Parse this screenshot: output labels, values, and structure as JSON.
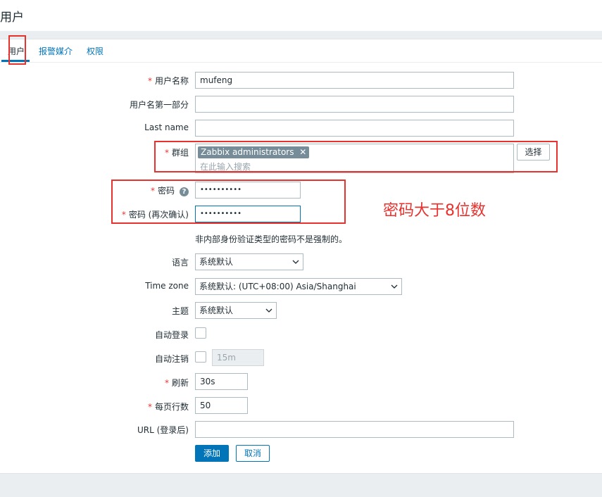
{
  "page": {
    "title": "用户"
  },
  "tabs": [
    {
      "label": "用户",
      "active": true
    },
    {
      "label": "报警媒介",
      "active": false
    },
    {
      "label": "权限",
      "active": false
    }
  ],
  "form": {
    "username": {
      "label": "用户名称",
      "value": "mufeng",
      "required": true
    },
    "first_name": {
      "label": "用户名第一部分",
      "value": ""
    },
    "last_name": {
      "label": "Last name",
      "value": ""
    },
    "groups": {
      "label": "群组",
      "required": true,
      "chips": [
        "Zabbix administrators"
      ],
      "placeholder": "在此输入搜索",
      "select_button": "选择"
    },
    "password": {
      "label": "密码",
      "mask": "••••••••••",
      "required": true,
      "help_icon": "question-circle-icon"
    },
    "password_confirm": {
      "label": "密码 (再次确认)",
      "mask": "••••••••••",
      "required": true
    },
    "password_hint": "非内部身份验证类型的密码不是强制的。",
    "language": {
      "label": "语言",
      "value": "系统默认"
    },
    "timezone": {
      "label": "Time zone",
      "value": "系统默认: (UTC+08:00) Asia/Shanghai"
    },
    "theme": {
      "label": "主题",
      "value": "系统默认"
    },
    "autologin": {
      "label": "自动登录",
      "checked": false
    },
    "autologout": {
      "label": "自动注销",
      "checked": false,
      "value": "15m"
    },
    "refresh": {
      "label": "刷新",
      "value": "30s",
      "required": true
    },
    "rows_per_page": {
      "label": "每页行数",
      "value": "50",
      "required": true
    },
    "url": {
      "label": "URL (登录后)",
      "value": ""
    },
    "buttons": {
      "add": "添加",
      "cancel": "取消"
    }
  },
  "annotation": {
    "text": "密码大于8位数",
    "color": "#e8322e"
  },
  "colors": {
    "accent": "#0275b8",
    "required": "#e33734",
    "annotation": "#e8322e"
  }
}
